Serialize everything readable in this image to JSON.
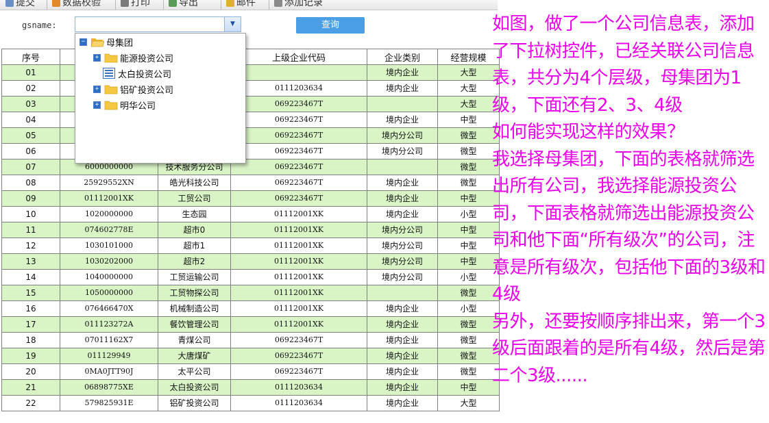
{
  "toolbar": {
    "items": [
      {
        "label": "提交",
        "icon": "submit-icon"
      },
      {
        "label": "数据校验",
        "icon": "validate-icon"
      },
      {
        "label": "打印",
        "icon": "print-icon"
      },
      {
        "label": "导出",
        "icon": "export-icon"
      },
      {
        "label": "邮件",
        "icon": "mail-icon"
      },
      {
        "label": "添加记录",
        "icon": "add-record-icon"
      }
    ]
  },
  "filter": {
    "label": "gsname:",
    "value": "",
    "query_label": "查询"
  },
  "tree": {
    "nodes": [
      {
        "label": "母集团",
        "level": 0,
        "expanded": true,
        "icon": "open-folder-icon"
      },
      {
        "label": "能源投资公司",
        "level": 1,
        "expanded": false,
        "icon": "folder-icon"
      },
      {
        "label": "太白投资公司",
        "level": 1,
        "leaf": true,
        "icon": "document-icon"
      },
      {
        "label": "铝矿投资公司",
        "level": 1,
        "expanded": false,
        "icon": "folder-icon"
      },
      {
        "label": "明华公司",
        "level": 1,
        "expanded": false,
        "icon": "folder-icon"
      }
    ]
  },
  "table": {
    "headers": [
      "序号",
      "",
      "",
      "上级企业代码",
      "企业类别",
      "经营规模"
    ],
    "rows": [
      [
        "01",
        "",
        "",
        "",
        "境内企业",
        "大型"
      ],
      [
        "02",
        "",
        "",
        "0111203634",
        "境内企业",
        "大型"
      ],
      [
        "03",
        "",
        "",
        "069223467T",
        "",
        "大型"
      ],
      [
        "04",
        "",
        "",
        "069223467T",
        "境内企业",
        "中型"
      ],
      [
        "05",
        "",
        "",
        "069223467T",
        "境内分公司",
        "微型"
      ],
      [
        "06",
        "",
        "",
        "069223467T",
        "境内分公司",
        "微型"
      ],
      [
        "07",
        "6000000000",
        "技术服务分公司",
        "069223467T",
        "",
        "微型"
      ],
      [
        "08",
        "25929552XN",
        "皓光科技公司",
        "069223467T",
        "境内企业",
        "微型"
      ],
      [
        "09",
        "01112001XK",
        "工贸公司",
        "069223467T",
        "境内企业",
        "中型"
      ],
      [
        "10",
        "1020000000",
        "生态园",
        "01112001XK",
        "境内企业",
        "小型"
      ],
      [
        "11",
        "074602778E",
        "超市0",
        "01112001XK",
        "境内分公司",
        "中型"
      ],
      [
        "12",
        "1030101000",
        "超市1",
        "01112001XK",
        "境内分公司",
        "中型"
      ],
      [
        "13",
        "1030202000",
        "超市2",
        "01112001XK",
        "境内分公司",
        "中型"
      ],
      [
        "14",
        "1040000000",
        "工贸运输公司",
        "01112001XK",
        "境内分公司",
        "小型"
      ],
      [
        "15",
        "1050000000",
        "工贸物探公司",
        "01112001XK",
        "",
        "微型"
      ],
      [
        "16",
        "076466470X",
        "机械制造公司",
        "01112001XK",
        "境内企业",
        "小型"
      ],
      [
        "17",
        "011123272A",
        "餐饮管理公司",
        "01112001XK",
        "境内企业",
        "微型"
      ],
      [
        "18",
        "07011162X7",
        "青煤公司",
        "069223467T",
        "境内企业",
        "微型"
      ],
      [
        "19",
        "011129949",
        "大唐煤矿",
        "069223467T",
        "境内企业",
        "微型"
      ],
      [
        "20",
        "0MA0JTT90J",
        "太平公司",
        "069223467T",
        "境内企业",
        "微型"
      ],
      [
        "21",
        "06898775XE",
        "太白投资公司",
        "0111203634",
        "境内企业",
        "中型"
      ],
      [
        "22",
        "579825931E",
        "铝矿投资公司",
        "0111203634",
        "境内企业",
        "大型"
      ]
    ]
  },
  "annotation": "如图，做了一个公司信息表，添加了下拉树控件，已经关联公司信息表，共分为4个层级，母集团为1级，下面还有2、3、4级\n如何能实现这样的效果？\n我选择母集团，下面的表格就筛选出所有公司，我选择能源投资公司，下面表格就筛选出能源投资公司和他下面“所有级次”的公司，注意是所有级次，包括他下面的3级和4级\n另外，还要按顺序排出来，第一个3级后面跟着的是所有4级，然后是第二个3级......",
  "colors": {
    "row_even": "#d9f5c6",
    "note_text": "#ea00ea",
    "query_button": "#4a9fe5",
    "tree_expander": "#2d6fc7",
    "folder": "#f5c842"
  }
}
